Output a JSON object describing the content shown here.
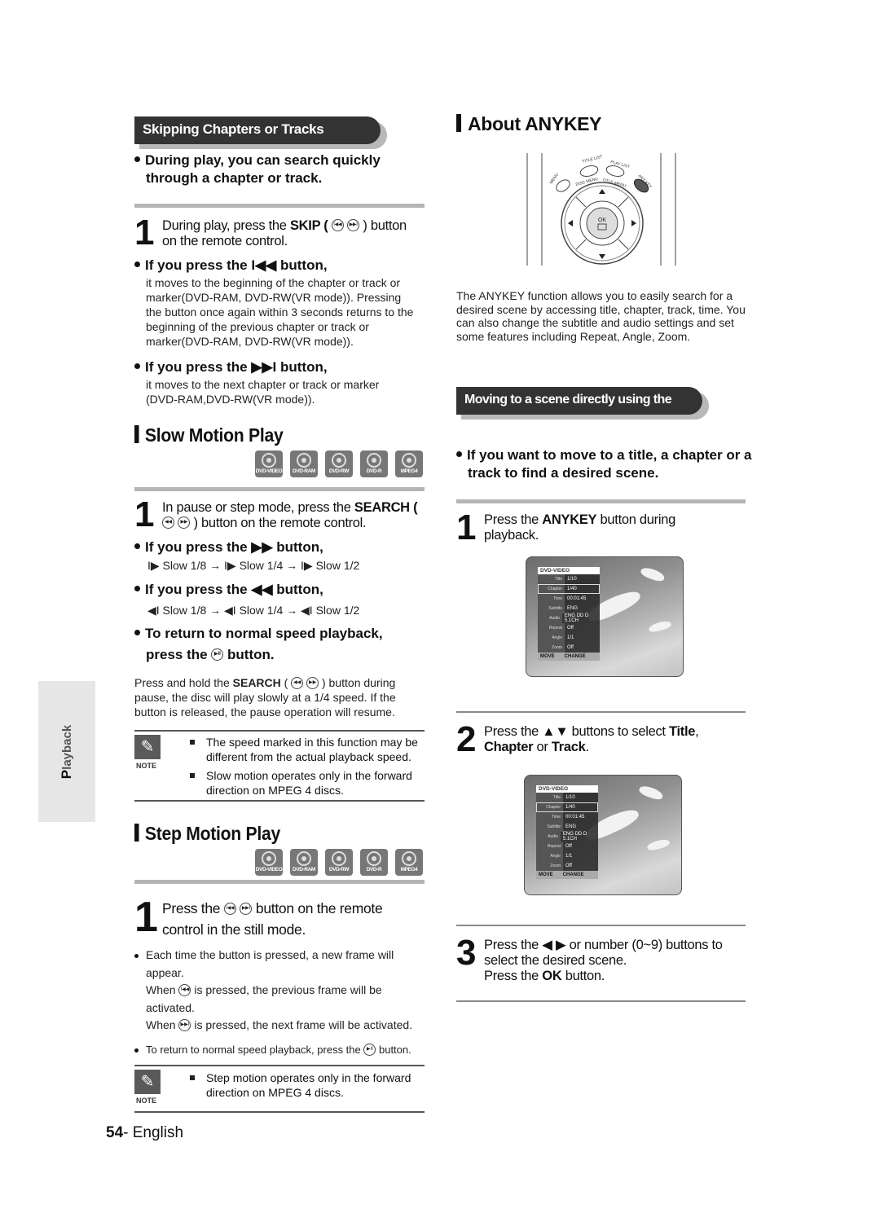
{
  "side_tab": {
    "label_first": "P",
    "label_rest": "layback"
  },
  "left": {
    "skipping": {
      "header": "Skipping Chapters or Tracks",
      "intro": "During play, you can search quickly through a chapter or track.",
      "step1": {
        "num": "1",
        "pre": "During play, press the ",
        "bold": "SKIP (",
        "post": " ) button on the remote control."
      },
      "prev": {
        "head_pre": "If you press the ",
        "glyph": "I◀◀",
        "head_post": " button,",
        "body": "it moves to the beginning of the chapter or track or marker(DVD-RAM, DVD-RW(VR mode)). Pressing the button once again within 3 seconds returns to the beginning of the previous chapter or track or marker(DVD-RAM, DVD-RW(VR mode))."
      },
      "next": {
        "head_pre": "If you press the ",
        "glyph": "▶▶I",
        "head_post": " button,",
        "body": "it moves to the next chapter or track or marker (DVD-RAM,DVD-RW(VR mode))."
      }
    },
    "slow": {
      "title": "Slow Motion Play",
      "discs": [
        "DVD-VIDEO",
        "DVD-RAM",
        "DVD-RW",
        "DVD-R",
        "MPEG4"
      ],
      "step1": {
        "num": "1",
        "pre": "In pause or step mode, press the ",
        "bold": "SEARCH (",
        "post": " ) button on the remote control."
      },
      "fwd": {
        "head_pre": "If you press the ",
        "glyph": "▶▶",
        "head_post": " button,",
        "seq": "I▶ Slow 1/8 → I▶ Slow 1/4 → I▶ Slow 1/2"
      },
      "rev": {
        "head_pre": "If you press the ",
        "glyph": "◀◀",
        "head_post": " button,",
        "seq": "◀I Slow 1/8 → ◀I Slow 1/4 → ◀I Slow 1/2"
      },
      "normal": {
        "line1": "To return to normal speed playback,",
        "line2_pre": "press the ",
        "line2_post": " button."
      },
      "hold_pre": "Press and hold the ",
      "hold_bold": "SEARCH",
      "hold_post": " button during pause, the disc will play slowly at a 1/4 speed. If the button is released, the pause operation will resume.",
      "note_label": "NOTE",
      "notes": [
        "The speed marked in this function may be different from the actual playback speed.",
        "Slow motion operates only in the forward direction on MPEG 4 discs."
      ]
    },
    "step": {
      "title": "Step Motion Play",
      "discs": [
        "DVD-VIDEO",
        "DVD-RAM",
        "DVD-RW",
        "DVD-R",
        "MPEG4"
      ],
      "step1": {
        "num": "1",
        "pre": "Press the ",
        "post": " button on the remote control in the still mode."
      },
      "b1_line1": "Each time the button is pressed, a new frame will appear.",
      "b1_when1_pre": "When ",
      "b1_when1_post": " is pressed, the previous frame will be activated.",
      "b1_when2_pre": "When ",
      "b1_when2_post": " is pressed, the next frame will be activated.",
      "b2_pre": "To return to normal speed playback, press the ",
      "b2_post": " button.",
      "note_label": "NOTE",
      "notes": [
        "Step motion operates only in the forward direction on MPEG 4 discs."
      ]
    },
    "page_number": "54",
    "page_lang": "- English"
  },
  "right": {
    "about": {
      "title": "About ANYKEY",
      "remote_labels": {
        "menu": "MENU",
        "title_list": "TITLE LIST",
        "play_list": "PLAY LIST",
        "any_key": "ANY KEY",
        "disc_menu": "DISC MENU",
        "title_menu": "TITLE MENU",
        "ok": "OK"
      },
      "description": "The ANYKEY function allows you to easily search for a desired scene by accessing title, chapter, track, time. You can also change the subtitle and audio settings and set some features including Repeat, Angle, Zoom."
    },
    "moving": {
      "header": "Moving to a scene directly using the ANYKEY",
      "intro": "If you want to move to a title, a chapter or a track to find a desired scene.",
      "step1": {
        "num": "1",
        "pre": "Press the ",
        "bold": "ANYKEY",
        "post": " button during playback."
      },
      "step2": {
        "num": "2",
        "pre": "Press the ▲▼ buttons to select ",
        "b1": "Title",
        "mid1": ", ",
        "b2": "Chapter",
        "mid2": " or ",
        "b3": "Track",
        "end": "."
      },
      "step3": {
        "num": "3",
        "line1": "Press the ◀ ▶ or number (0~9) buttons to select the desired scene.",
        "line2_pre": "Press the ",
        "line2_bold": "OK",
        "line2_post": " button."
      }
    },
    "osd": {
      "header": "DVD-VIDEO",
      "rows": [
        {
          "key": "Title",
          "value": "1/10"
        },
        {
          "key": "Chapter",
          "value": "1/40"
        },
        {
          "key": "Time",
          "value": "00:01:45"
        },
        {
          "key": "Subtitle",
          "value": "ENG"
        },
        {
          "key": "Audio",
          "value": "ENG DD D 5.1CH"
        },
        {
          "key": "Repeat",
          "value": "Off"
        },
        {
          "key": "Angle",
          "value": "1/1"
        },
        {
          "key": "Zoom",
          "value": "Off"
        }
      ],
      "footer_move": "MOVE",
      "footer_change": "CHANGE"
    }
  }
}
